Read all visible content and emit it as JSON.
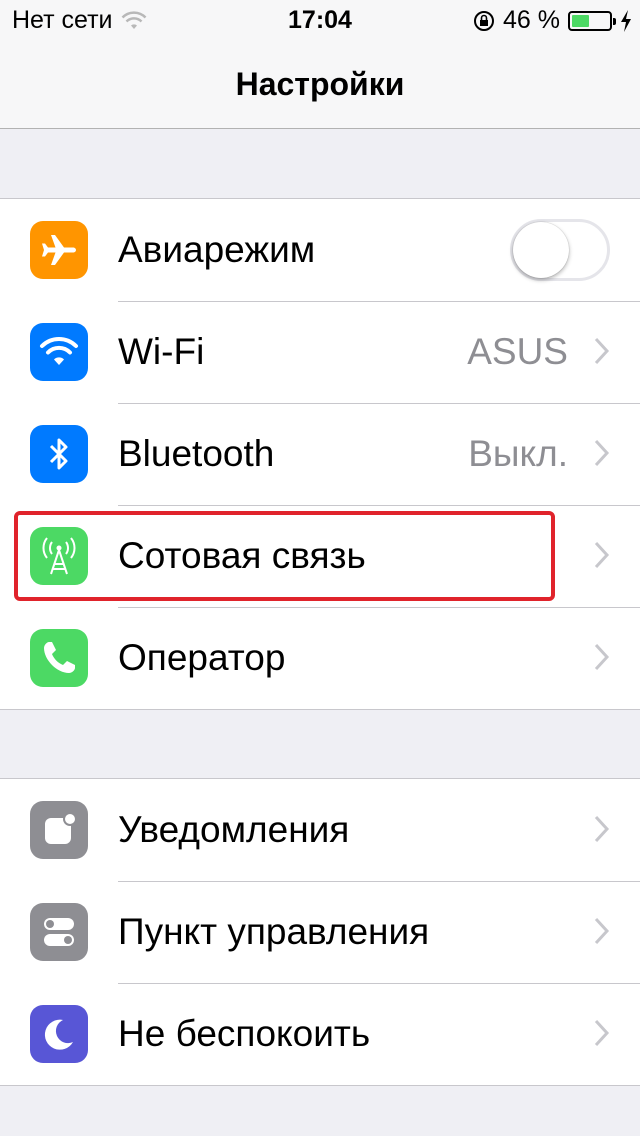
{
  "status_bar": {
    "carrier": "Нет сети",
    "time": "17:04",
    "battery_percent": "46 %",
    "battery_level": 0.46,
    "icons": [
      "wifi-icon",
      "rotation-lock-icon",
      "battery-icon",
      "charging-bolt-icon"
    ]
  },
  "navbar": {
    "title": "Настройки"
  },
  "colors": {
    "airplane": "#ff9500",
    "wifi": "#007aff",
    "bluetooth": "#007aff",
    "cellular": "#4cd964",
    "carrier": "#4cd964",
    "notifications": "#8e8e93",
    "control_center": "#8e8e93",
    "do_not_disturb": "#5856d6",
    "highlight": "#e0232b",
    "toggle_off": "#e5e5ea"
  },
  "group1": {
    "airplane": {
      "label": "Авиарежим",
      "toggle_on": false,
      "icon": "airplane-icon"
    },
    "wifi": {
      "label": "Wi-Fi",
      "value": "ASUS",
      "icon": "wifi-icon"
    },
    "bluetooth": {
      "label": "Bluetooth",
      "value": "Выкл.",
      "icon": "bluetooth-icon"
    },
    "cellular": {
      "label": "Сотовая связь",
      "icon": "antenna-icon"
    },
    "carrier": {
      "label": "Оператор",
      "icon": "phone-icon"
    }
  },
  "group2": {
    "notifications": {
      "label": "Уведомления",
      "icon": "notifications-icon"
    },
    "control_center": {
      "label": "Пункт управления",
      "icon": "control-center-icon"
    },
    "do_not_disturb": {
      "label": "Не беспокоить",
      "icon": "moon-icon"
    }
  }
}
